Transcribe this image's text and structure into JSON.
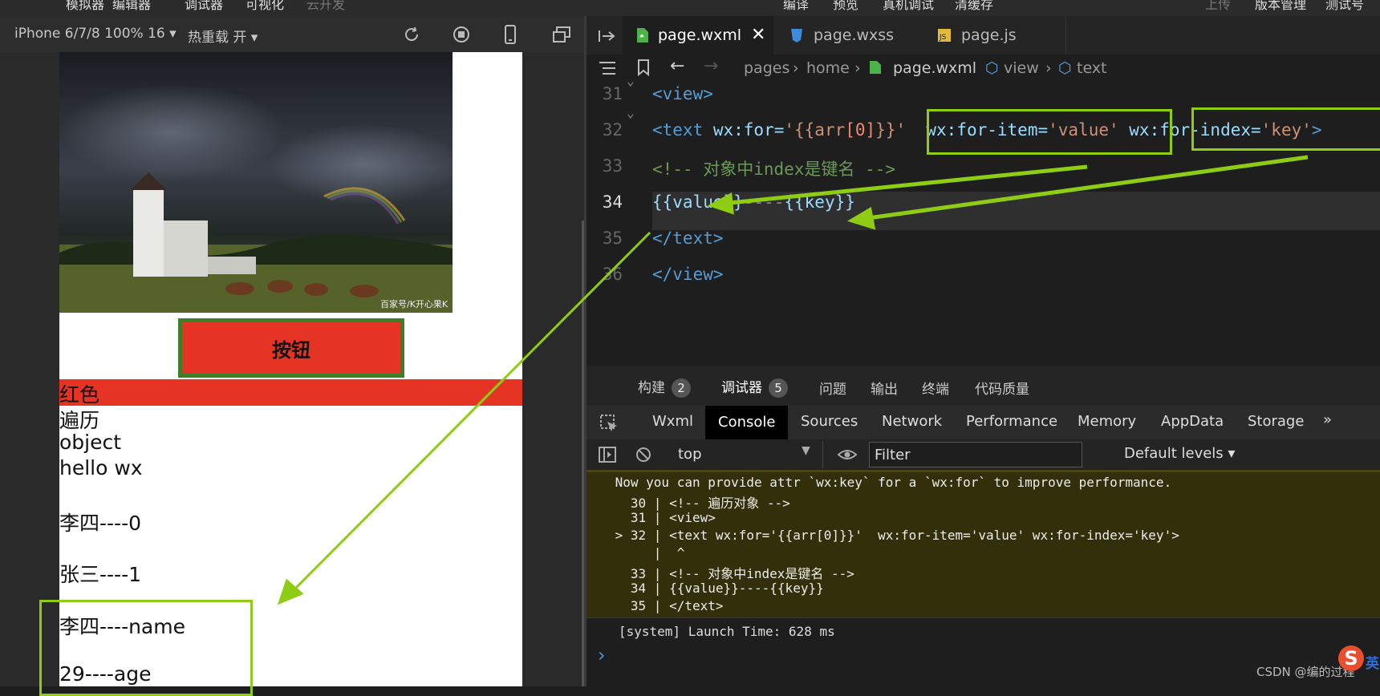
{
  "menubar": {
    "items": [
      "模拟器",
      "编辑器",
      "调试器",
      "可视化",
      "云开发"
    ],
    "right_items": [
      "编译",
      "预览",
      "真机调试",
      "清缓存"
    ],
    "far_right": [
      "上传",
      "版本管理",
      "测试号"
    ]
  },
  "simulator": {
    "device_label": "iPhone 6/7/8 100% 16 ▾",
    "hot_reload_label": "热重载 开 ▾",
    "button_label": "按钮",
    "image_caption": "百家号/K开心果K",
    "lines": [
      "红色",
      "遍历",
      "object",
      "hello wx",
      "李四----0",
      "张三----1",
      "李四----name",
      "29----age"
    ],
    "colors": {
      "red_bar": "#e53424",
      "button_fill": "#e53424",
      "button_border": "#3f7d2a",
      "highlight": "#8fcc14"
    }
  },
  "editor": {
    "tabs": [
      {
        "label": "page.wxml",
        "icon": "wxml-file-icon",
        "active": true
      },
      {
        "label": "page.wxss",
        "icon": "css-file-icon",
        "active": false
      },
      {
        "label": "page.js",
        "icon": "js-file-icon",
        "active": false
      }
    ],
    "breadcrumb": [
      "pages",
      "home",
      "page.wxml",
      "view",
      "text"
    ],
    "lines": [
      {
        "n": "31",
        "parts": [
          [
            "tag",
            "<view>"
          ]
        ]
      },
      {
        "n": "32",
        "parts": [
          [
            "tag",
            "<text "
          ],
          [
            "attr",
            "wx:for="
          ],
          [
            "str",
            "'{{arr"
          ],
          [
            "str",
            "[0]"
          ],
          [
            "str",
            "}}'"
          ],
          [
            "attr",
            "  wx:for-item="
          ],
          [
            "str",
            "'value'"
          ],
          [
            "attr",
            " wx:for-index="
          ],
          [
            "str",
            "'key'"
          ],
          [
            "tag",
            ">"
          ]
        ]
      },
      {
        "n": "33",
        "parts": [
          [
            "cmt",
            "<!-- 对象中index是键名 -->"
          ]
        ]
      },
      {
        "n": "34",
        "parts": [
          [
            "brace",
            "{{value}}"
          ],
          [
            "dim",
            "----"
          ],
          [
            "brace",
            "{{key}}"
          ]
        ]
      },
      {
        "n": "35",
        "parts": [
          [
            "tag",
            "</text>"
          ]
        ]
      },
      {
        "n": "36",
        "parts": [
          [
            "tag",
            "</view>"
          ]
        ]
      }
    ]
  },
  "panel": {
    "tabs": [
      {
        "label": "构建",
        "badge": "2"
      },
      {
        "label": "调试器",
        "badge": "5"
      },
      {
        "label": "问题"
      },
      {
        "label": "输出"
      },
      {
        "label": "终端"
      },
      {
        "label": "代码质量"
      }
    ],
    "devtools_tabs": [
      "Wxml",
      "Console",
      "Sources",
      "Network",
      "Performance",
      "Memory",
      "AppData",
      "Storage",
      "»"
    ],
    "context": "top",
    "filter_placeholder": "Filter",
    "levels": "Default levels ▾",
    "console_lines": [
      " Now you can provide attr `wx:key` for a `wx:for` to improve performance.",
      "   30 | <!-- 遍历对象 -->",
      "   31 | <view>",
      " > 32 | <text wx:for='{{arr[0]}}'  wx:for-item='value' wx:for-index='key'>",
      "      |  ^",
      "   33 | <!-- 对象中index是键名 -->",
      "   34 | {{value}}----{{key}}",
      "   35 | </text>"
    ],
    "system_log": "[system] Launch Time: 628 ms",
    "prompt": "›"
  },
  "watermark": "CSDN @编的过程",
  "ime_label": "英"
}
